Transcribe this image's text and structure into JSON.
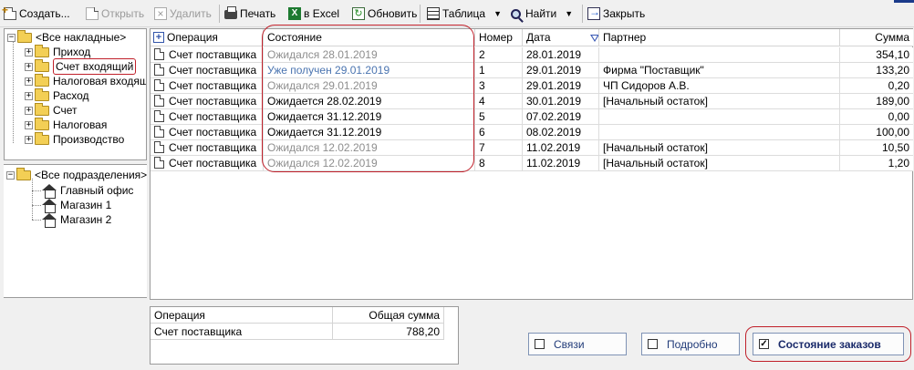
{
  "toolbar": {
    "create": "Создать...",
    "open": "Открыть",
    "delete": "Удалить",
    "print": "Печать",
    "excel": "в Excel",
    "refresh": "Обновить",
    "table": "Таблица",
    "find": "Найти",
    "close": "Закрыть"
  },
  "invoice_tree": {
    "root": "<Все накладные>",
    "items": [
      "Приход",
      "Счет входящий",
      "Налоговая входящ",
      "Расход",
      "Счет",
      "Налоговая",
      "Производство"
    ]
  },
  "division_tree": {
    "root": "<Все подразделения>",
    "items": [
      "Главный офис",
      "Магазин 1",
      "Магазин 2"
    ]
  },
  "grid": {
    "columns": [
      "Операция",
      "Состояние",
      "Номер",
      "Дата",
      "Партнер",
      "Сумма"
    ],
    "rows": [
      {
        "op": "Счет поставщика",
        "state": "Ожидался 28.01.2019",
        "state_style": "gray",
        "num": "2",
        "date": "28.01.2019",
        "partner": "",
        "sum": "354,10"
      },
      {
        "op": "Счет поставщика",
        "state": "Уже получен 29.01.2019",
        "state_style": "blue",
        "num": "1",
        "date": "29.01.2019",
        "partner": "Фирма \"Поставщик\"",
        "sum": "133,20"
      },
      {
        "op": "Счет поставщика",
        "state": "Ожидался 29.01.2019",
        "state_style": "gray",
        "num": "3",
        "date": "29.01.2019",
        "partner": "ЧП Сидоров А.В.",
        "sum": "0,20"
      },
      {
        "op": "Счет поставщика",
        "state": "Ожидается 28.02.2019",
        "state_style": "black",
        "num": "4",
        "date": "30.01.2019",
        "partner": "[Начальный остаток]",
        "sum": "189,00"
      },
      {
        "op": "Счет поставщика",
        "state": "Ожидается 31.12.2019",
        "state_style": "black",
        "num": "5",
        "date": "07.02.2019",
        "partner": "",
        "sum": "0,00"
      },
      {
        "op": "Счет поставщика",
        "state": "Ожидается 31.12.2019",
        "state_style": "black",
        "num": "6",
        "date": "08.02.2019",
        "partner": "",
        "sum": "100,00"
      },
      {
        "op": "Счет поставщика",
        "state": "Ожидался 12.02.2019",
        "state_style": "gray",
        "num": "7",
        "date": "11.02.2019",
        "partner": "[Начальный остаток]",
        "sum": "10,50"
      },
      {
        "op": "Счет поставщика",
        "state": "Ожидался 12.02.2019",
        "state_style": "gray",
        "num": "8",
        "date": "11.02.2019",
        "partner": "[Начальный остаток]",
        "sum": "1,20"
      }
    ]
  },
  "summary": {
    "columns": [
      "Операция",
      "Общая сумма"
    ],
    "row": {
      "op": "Счет поставщика",
      "total": "788,20"
    }
  },
  "buttons": {
    "links": "Связи",
    "details": "Подробно",
    "order_state": "Состояние заказов",
    "order_state_checked": true
  },
  "colors": {
    "gray_state": "#8e8e8e",
    "blue_state": "#4a74b0",
    "highlight": "#c0202a"
  }
}
